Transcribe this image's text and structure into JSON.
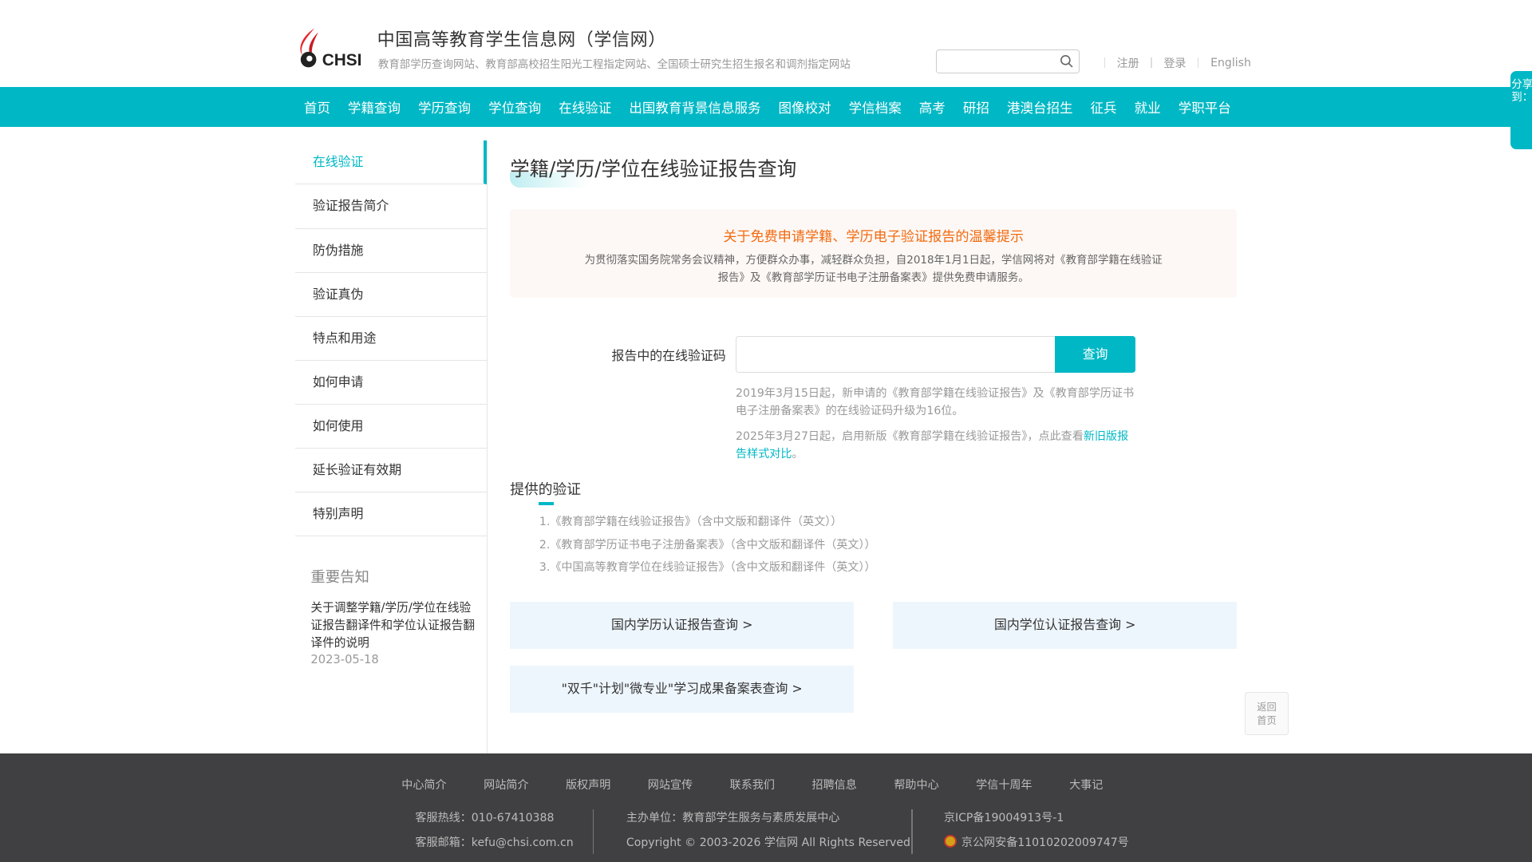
{
  "header": {
    "logo_text": "CHSI",
    "title": "中国高等教育学生信息网（学信网）",
    "subtitle": "教育部学历查询网站、教育部高校招生阳光工程指定网站、全国硕士研究生招生报名和调剂指定网站",
    "search_placeholder": "",
    "links": [
      "注册",
      "登录",
      "English"
    ]
  },
  "nav": [
    "首页",
    "学籍查询",
    "学历查询",
    "学位查询",
    "在线验证",
    "出国教育背景信息服务",
    "图像校对",
    "学信档案",
    "高考",
    "研招",
    "港澳台招生",
    "征兵",
    "就业",
    "学职平台"
  ],
  "share": "分享到：",
  "sidebar": {
    "items": [
      "在线验证",
      "验证报告简介",
      "防伪措施",
      "验证真伪",
      "特点和用途",
      "如何申请",
      "如何使用",
      "延长验证有效期",
      "特别声明"
    ],
    "notice_heading": "重要告知",
    "notice_title": "关于调整学籍/学历/学位在线验证报告翻译件和学位认证报告翻译件的说明",
    "notice_date": "2023-05-18"
  },
  "main": {
    "title": "学籍/学历/学位在线验证报告查询",
    "tip_heading": "关于免费申请学籍、学历电子验证报告的温馨提示",
    "tip_body": "为贯彻落实国务院常务会议精神，方便群众办事，减轻群众负担，自2018年1月1日起，学信网将对《教育部学籍在线验证报告》及《教育部学历证书电子注册备案表》提供免费申请服务。",
    "code_label": "报告中的在线验证码",
    "code_value": "",
    "query_button": "查询",
    "hint1": "2019年3月15日起，新申请的《教育部学籍在线验证报告》及《教育部学历证书电子注册备案表》的在线验证码升级为16位。",
    "hint2_text": "2025年3月27日起，启用新版《教育部学籍在线验证报告》，点此查看",
    "hint2_link": "新旧版报告样式对比",
    "hint2_end": "。",
    "provided_heading": "提供的验证",
    "provided": [
      "1.《教育部学籍在线验证报告》（含中文版和翻译件（英文））",
      "2.《教育部学历证书电子注册备案表》（含中文版和翻译件（英文））",
      "3.《中国高等教育学位在线验证报告》（含中文版和翻译件（英文））"
    ],
    "cards": [
      "国内学历认证报告查询 >",
      "国内学位认证报告查询 >",
      "\"双千\"计划\"微专业\"学习成果备案表查询 >"
    ]
  },
  "back_home": [
    "返回",
    "首页"
  ],
  "footer": {
    "links": [
      "中心简介",
      "网站简介",
      "版权声明",
      "网站宣传",
      "联系我们",
      "招聘信息",
      "帮助中心",
      "学信十周年",
      "大事记"
    ],
    "hotline": "客服热线：010-67410388",
    "email": "客服邮箱：kefu@chsi.com.cn",
    "host": "主办单位：教育部学生服务与素质发展中心",
    "copyright": "Copyright © 2003-2026 学信网 All Rights Reserved",
    "icp": "京ICP备19004913号-1",
    "police": "京公网安备11010202009747号"
  },
  "colors": {
    "accent": "#00b8c5",
    "tip": "#f26a10",
    "footer": "#403f41"
  }
}
